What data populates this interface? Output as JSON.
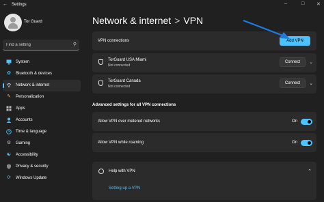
{
  "window": {
    "title": "Settings"
  },
  "profile": {
    "name": "Tor Guard"
  },
  "search": {
    "placeholder": "Find a setting"
  },
  "nav": {
    "items": [
      {
        "label": "System",
        "icon": "monitor-icon"
      },
      {
        "label": "Bluetooth & devices",
        "icon": "bluetooth-icon"
      },
      {
        "label": "Network & internet",
        "icon": "wifi-icon",
        "active": true
      },
      {
        "label": "Personalization",
        "icon": "brush-icon"
      },
      {
        "label": "Apps",
        "icon": "apps-icon"
      },
      {
        "label": "Accounts",
        "icon": "person-icon"
      },
      {
        "label": "Time & language",
        "icon": "clock-icon"
      },
      {
        "label": "Gaming",
        "icon": "gamepad-icon"
      },
      {
        "label": "Accessibility",
        "icon": "accessibility-icon"
      },
      {
        "label": "Privacy & security",
        "icon": "shield-icon"
      },
      {
        "label": "Windows Update",
        "icon": "update-icon"
      }
    ]
  },
  "breadcrumb": {
    "parent": "Network & internet",
    "separator": ">",
    "current": "VPN"
  },
  "vpn_connections": {
    "label": "VPN connections",
    "add_button": "Add VPN"
  },
  "connections": [
    {
      "name": "TorGuard USA Miami",
      "status": "Not connected",
      "button": "Connect"
    },
    {
      "name": "TorGuard Canada",
      "status": "Not connected",
      "button": "Connect"
    }
  ],
  "advanced": {
    "title": "Advanced settings for all VPN connections",
    "settings": [
      {
        "label": "Allow VPN over metered networks",
        "state": "On",
        "enabled": true
      },
      {
        "label": "Allow VPN while roaming",
        "state": "On",
        "enabled": true
      }
    ]
  },
  "help": {
    "title": "Help with VPN",
    "link": "Setting up a VPN"
  },
  "colors": {
    "accent": "#4cc2ff",
    "background": "#202020",
    "card": "#2b2b2b",
    "annotation_arrow": "#1e7be0"
  }
}
